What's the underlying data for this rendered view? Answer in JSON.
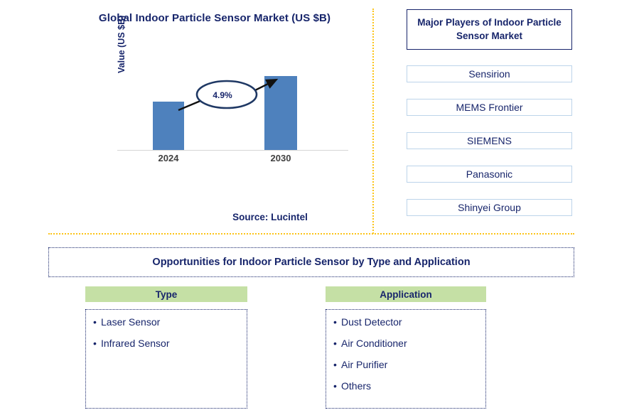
{
  "chart": {
    "title": "Global Indoor Particle Sensor Market (US $B)",
    "ylabel": "Value (US $B)",
    "cagr_label": "4.9%",
    "source": "Source: Lucintel"
  },
  "chart_data": {
    "type": "bar",
    "title": "Global Indoor Particle Sensor Market (US $B)",
    "categories": [
      "2024",
      "2030"
    ],
    "values": [
      59,
      90
    ],
    "value_unit": "US $B",
    "xlabel": "",
    "ylabel": "Value (US $B)",
    "ylim": [
      0,
      100
    ],
    "grid": false,
    "legend": "none",
    "annotations": [
      {
        "text": "4.9%",
        "kind": "cagr-callout",
        "from": "2024",
        "to": "2030"
      }
    ],
    "series": [
      {
        "name": "Value (US $B)",
        "values": [
          59,
          90
        ],
        "color": "#4e81bd"
      }
    ],
    "source": "Source: Lucintel"
  },
  "players": {
    "header": "Major Players of Indoor Particle Sensor Market",
    "items": [
      {
        "name": "Sensirion"
      },
      {
        "name": "MEMS Frontier"
      },
      {
        "name": "SIEMENS"
      },
      {
        "name": "Panasonic"
      },
      {
        "name": "Shinyei Group"
      }
    ]
  },
  "opportunities": {
    "banner": "Opportunities for Indoor Particle Sensor by Type and Application",
    "columns": [
      {
        "heading": "Type",
        "items": [
          "Laser Sensor",
          "Infrared Sensor"
        ]
      },
      {
        "heading": "Application",
        "items": [
          "Dust Detector",
          "Air Conditioner",
          "Air Purifier",
          "Others"
        ]
      }
    ]
  },
  "colors": {
    "bar": "#4e81bd",
    "navy": "#17256b",
    "divider": "#fcc419",
    "heading_green": "#c5e0a5",
    "tick_gray": "#404040"
  }
}
